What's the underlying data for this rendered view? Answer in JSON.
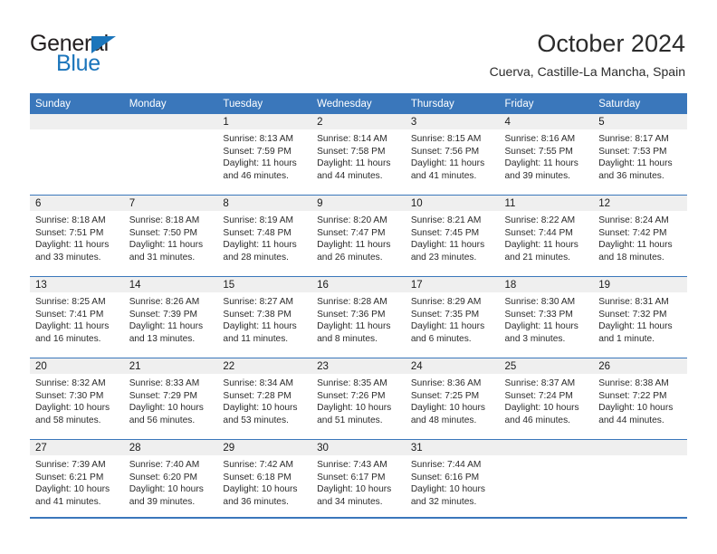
{
  "brand": {
    "name_top": "General",
    "name_bottom": "Blue",
    "accent_color": "#1b75bb",
    "triangle_icon": "triangle-logo-icon"
  },
  "header": {
    "month_title": "October 2024",
    "location": "Cuerva, Castille-La Mancha, Spain"
  },
  "calendar": {
    "header_bg": "#3a77bb",
    "daynum_bg": "#efefef",
    "weekday_headers": [
      "Sunday",
      "Monday",
      "Tuesday",
      "Wednesday",
      "Thursday",
      "Friday",
      "Saturday"
    ],
    "weeks": [
      [
        {
          "day": "",
          "sunrise": "",
          "sunset": "",
          "daylight": "",
          "empty": true
        },
        {
          "day": "",
          "sunrise": "",
          "sunset": "",
          "daylight": "",
          "empty": true
        },
        {
          "day": "1",
          "sunrise": "Sunrise: 8:13 AM",
          "sunset": "Sunset: 7:59 PM",
          "daylight": "Daylight: 11 hours and 46 minutes."
        },
        {
          "day": "2",
          "sunrise": "Sunrise: 8:14 AM",
          "sunset": "Sunset: 7:58 PM",
          "daylight": "Daylight: 11 hours and 44 minutes."
        },
        {
          "day": "3",
          "sunrise": "Sunrise: 8:15 AM",
          "sunset": "Sunset: 7:56 PM",
          "daylight": "Daylight: 11 hours and 41 minutes."
        },
        {
          "day": "4",
          "sunrise": "Sunrise: 8:16 AM",
          "sunset": "Sunset: 7:55 PM",
          "daylight": "Daylight: 11 hours and 39 minutes."
        },
        {
          "day": "5",
          "sunrise": "Sunrise: 8:17 AM",
          "sunset": "Sunset: 7:53 PM",
          "daylight": "Daylight: 11 hours and 36 minutes."
        }
      ],
      [
        {
          "day": "6",
          "sunrise": "Sunrise: 8:18 AM",
          "sunset": "Sunset: 7:51 PM",
          "daylight": "Daylight: 11 hours and 33 minutes."
        },
        {
          "day": "7",
          "sunrise": "Sunrise: 8:18 AM",
          "sunset": "Sunset: 7:50 PM",
          "daylight": "Daylight: 11 hours and 31 minutes."
        },
        {
          "day": "8",
          "sunrise": "Sunrise: 8:19 AM",
          "sunset": "Sunset: 7:48 PM",
          "daylight": "Daylight: 11 hours and 28 minutes."
        },
        {
          "day": "9",
          "sunrise": "Sunrise: 8:20 AM",
          "sunset": "Sunset: 7:47 PM",
          "daylight": "Daylight: 11 hours and 26 minutes."
        },
        {
          "day": "10",
          "sunrise": "Sunrise: 8:21 AM",
          "sunset": "Sunset: 7:45 PM",
          "daylight": "Daylight: 11 hours and 23 minutes."
        },
        {
          "day": "11",
          "sunrise": "Sunrise: 8:22 AM",
          "sunset": "Sunset: 7:44 PM",
          "daylight": "Daylight: 11 hours and 21 minutes."
        },
        {
          "day": "12",
          "sunrise": "Sunrise: 8:24 AM",
          "sunset": "Sunset: 7:42 PM",
          "daylight": "Daylight: 11 hours and 18 minutes."
        }
      ],
      [
        {
          "day": "13",
          "sunrise": "Sunrise: 8:25 AM",
          "sunset": "Sunset: 7:41 PM",
          "daylight": "Daylight: 11 hours and 16 minutes."
        },
        {
          "day": "14",
          "sunrise": "Sunrise: 8:26 AM",
          "sunset": "Sunset: 7:39 PM",
          "daylight": "Daylight: 11 hours and 13 minutes."
        },
        {
          "day": "15",
          "sunrise": "Sunrise: 8:27 AM",
          "sunset": "Sunset: 7:38 PM",
          "daylight": "Daylight: 11 hours and 11 minutes."
        },
        {
          "day": "16",
          "sunrise": "Sunrise: 8:28 AM",
          "sunset": "Sunset: 7:36 PM",
          "daylight": "Daylight: 11 hours and 8 minutes."
        },
        {
          "day": "17",
          "sunrise": "Sunrise: 8:29 AM",
          "sunset": "Sunset: 7:35 PM",
          "daylight": "Daylight: 11 hours and 6 minutes."
        },
        {
          "day": "18",
          "sunrise": "Sunrise: 8:30 AM",
          "sunset": "Sunset: 7:33 PM",
          "daylight": "Daylight: 11 hours and 3 minutes."
        },
        {
          "day": "19",
          "sunrise": "Sunrise: 8:31 AM",
          "sunset": "Sunset: 7:32 PM",
          "daylight": "Daylight: 11 hours and 1 minute."
        }
      ],
      [
        {
          "day": "20",
          "sunrise": "Sunrise: 8:32 AM",
          "sunset": "Sunset: 7:30 PM",
          "daylight": "Daylight: 10 hours and 58 minutes."
        },
        {
          "day": "21",
          "sunrise": "Sunrise: 8:33 AM",
          "sunset": "Sunset: 7:29 PM",
          "daylight": "Daylight: 10 hours and 56 minutes."
        },
        {
          "day": "22",
          "sunrise": "Sunrise: 8:34 AM",
          "sunset": "Sunset: 7:28 PM",
          "daylight": "Daylight: 10 hours and 53 minutes."
        },
        {
          "day": "23",
          "sunrise": "Sunrise: 8:35 AM",
          "sunset": "Sunset: 7:26 PM",
          "daylight": "Daylight: 10 hours and 51 minutes."
        },
        {
          "day": "24",
          "sunrise": "Sunrise: 8:36 AM",
          "sunset": "Sunset: 7:25 PM",
          "daylight": "Daylight: 10 hours and 48 minutes."
        },
        {
          "day": "25",
          "sunrise": "Sunrise: 8:37 AM",
          "sunset": "Sunset: 7:24 PM",
          "daylight": "Daylight: 10 hours and 46 minutes."
        },
        {
          "day": "26",
          "sunrise": "Sunrise: 8:38 AM",
          "sunset": "Sunset: 7:22 PM",
          "daylight": "Daylight: 10 hours and 44 minutes."
        }
      ],
      [
        {
          "day": "27",
          "sunrise": "Sunrise: 7:39 AM",
          "sunset": "Sunset: 6:21 PM",
          "daylight": "Daylight: 10 hours and 41 minutes."
        },
        {
          "day": "28",
          "sunrise": "Sunrise: 7:40 AM",
          "sunset": "Sunset: 6:20 PM",
          "daylight": "Daylight: 10 hours and 39 minutes."
        },
        {
          "day": "29",
          "sunrise": "Sunrise: 7:42 AM",
          "sunset": "Sunset: 6:18 PM",
          "daylight": "Daylight: 10 hours and 36 minutes."
        },
        {
          "day": "30",
          "sunrise": "Sunrise: 7:43 AM",
          "sunset": "Sunset: 6:17 PM",
          "daylight": "Daylight: 10 hours and 34 minutes."
        },
        {
          "day": "31",
          "sunrise": "Sunrise: 7:44 AM",
          "sunset": "Sunset: 6:16 PM",
          "daylight": "Daylight: 10 hours and 32 minutes."
        },
        {
          "day": "",
          "sunrise": "",
          "sunset": "",
          "daylight": "",
          "empty": true
        },
        {
          "day": "",
          "sunrise": "",
          "sunset": "",
          "daylight": "",
          "empty": true
        }
      ]
    ]
  }
}
